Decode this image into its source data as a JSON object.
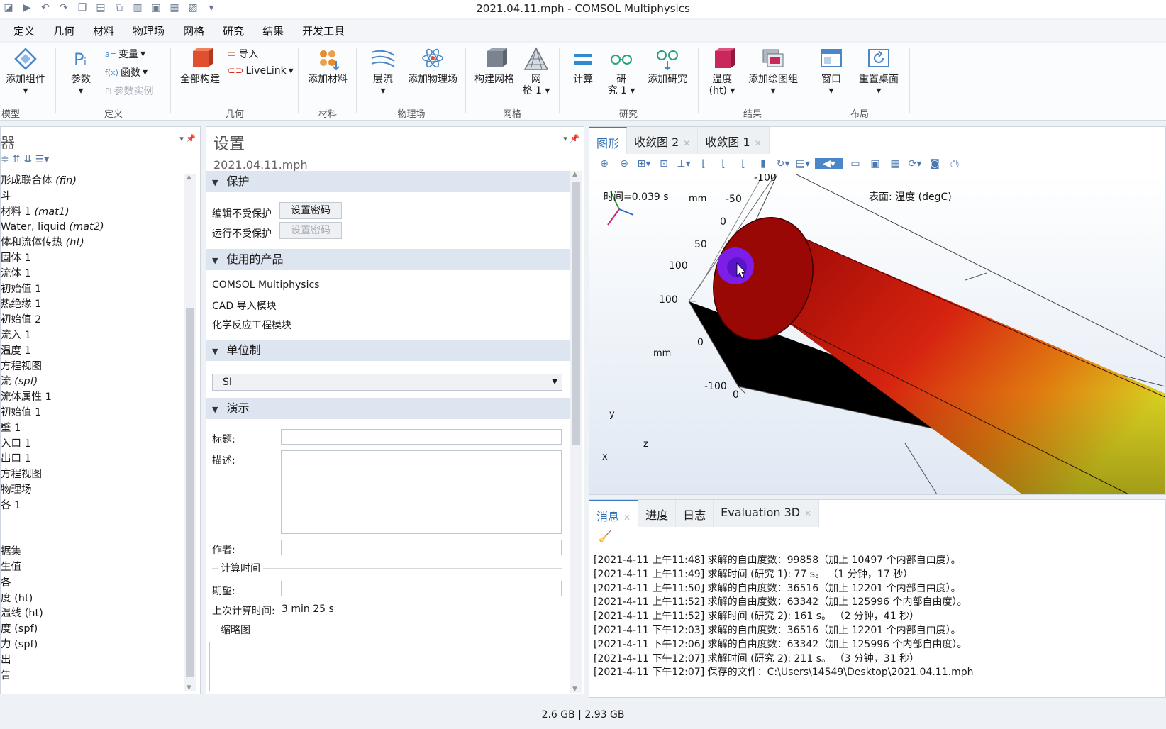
{
  "window": {
    "title": "2021.04.11.mph - COMSOL Multiphysics"
  },
  "menu": [
    "定义",
    "几何",
    "材料",
    "物理场",
    "网格",
    "研究",
    "结果",
    "开发工具"
  ],
  "ribbon": {
    "add_component": "添加组件",
    "group_model": "模型",
    "parameters": "参数",
    "variables": "变量",
    "functions": "函数",
    "param_instance": "参数实例",
    "group_definitions": "定义",
    "build_all": "全部构建",
    "import": "导入",
    "livelink": "LiveLink",
    "group_geometry": "几何",
    "add_material": "添加材料",
    "group_materials": "材料",
    "laminar_flow": "层流",
    "add_physics": "添加物理场",
    "group_physics": "物理场",
    "build_mesh": "构建网格",
    "mesh1_a": "网",
    "mesh1_b": "格 1",
    "group_mesh": "网格",
    "compute": "计算",
    "study1_a": "研",
    "study1_b": "究 1",
    "add_study": "添加研究",
    "group_study": "研究",
    "temperature_a": "温度",
    "temperature_b": "(ht)",
    "add_plot_group": "添加绘图组",
    "group_results": "结果",
    "windows": "窗口",
    "reset_desktop": "重置桌面",
    "group_layout": "布局"
  },
  "model_tree": {
    "title_fragment": "器",
    "items": [
      {
        "text": "形成联合体",
        "tag": "(fin)"
      },
      {
        "text": "斗",
        "tag": ""
      },
      {
        "text": "材料 1",
        "tag": "(mat1)"
      },
      {
        "text": "Water, liquid",
        "tag": "(mat2)"
      },
      {
        "text": "体和流体传热",
        "tag": "(ht)"
      },
      {
        "text": "固体 1",
        "tag": ""
      },
      {
        "text": "流体 1",
        "tag": ""
      },
      {
        "text": "初始值 1",
        "tag": ""
      },
      {
        "text": "热绝缘 1",
        "tag": ""
      },
      {
        "text": "初始值 2",
        "tag": ""
      },
      {
        "text": "流入 1",
        "tag": ""
      },
      {
        "text": "温度 1",
        "tag": ""
      },
      {
        "text": "方程视图",
        "tag": ""
      },
      {
        "text": "流",
        "tag": "(spf)"
      },
      {
        "text": "流体属性 1",
        "tag": ""
      },
      {
        "text": "初始值 1",
        "tag": ""
      },
      {
        "text": "壁 1",
        "tag": ""
      },
      {
        "text": "入口 1",
        "tag": ""
      },
      {
        "text": "出口 1",
        "tag": ""
      },
      {
        "text": "方程视图",
        "tag": ""
      },
      {
        "text": "物理场",
        "tag": ""
      },
      {
        "text": "各 1",
        "tag": ""
      },
      {
        "text": "",
        "tag": ""
      },
      {
        "text": "",
        "tag": ""
      },
      {
        "text": "据集",
        "tag": ""
      },
      {
        "text": "生值",
        "tag": ""
      },
      {
        "text": "各",
        "tag": ""
      },
      {
        "text": "度 (ht)",
        "tag": ""
      },
      {
        "text": "温线 (ht)",
        "tag": ""
      },
      {
        "text": "度 (spf)",
        "tag": ""
      },
      {
        "text": "力 (spf)",
        "tag": ""
      },
      {
        "text": "出",
        "tag": ""
      },
      {
        "text": "告",
        "tag": ""
      }
    ]
  },
  "settings": {
    "title": "设置",
    "subtitle": "2021.04.11.mph",
    "sec_protection": "保护",
    "edit_unprotected": "编辑不受保护",
    "run_unprotected": "运行不受保护",
    "set_password": "设置密码",
    "sec_products": "使用的产品",
    "products": [
      "COMSOL Multiphysics",
      "CAD 导入模块",
      "化学反应工程模块"
    ],
    "sec_units": "单位制",
    "unit_system": "SI",
    "sec_presentation": "演示",
    "label_title": "标题:",
    "label_description": "描述:",
    "label_author": "作者:",
    "compute_time_header": "计算时间",
    "label_expected": "期望:",
    "label_last_time": "上次计算时间:",
    "last_time_value": "3 min 25 s",
    "thumbnail_header": "缩略图"
  },
  "graphics": {
    "tabs": [
      "图形",
      "收敛图 2",
      "收敛图 1"
    ],
    "time_label": "时间=0.039 s",
    "surface_label": "表面: 温度 (degC)",
    "axis_top": [
      "-100",
      "-50",
      "0",
      "50",
      "100"
    ],
    "axis_left": [
      "100",
      "0",
      "-100"
    ],
    "axis_zero": "0",
    "unit_mm": "mm",
    "triad": [
      "y",
      "z",
      "x"
    ]
  },
  "messages": {
    "tabs": [
      "消息",
      "进度",
      "日志",
      "Evaluation 3D"
    ],
    "lines": [
      "[2021-4-11 上午11:48] 求解的自由度数：99858（加上 10497 个内部自由度）。",
      "[2021-4-11 上午11:49] 求解时间 (研究 1): 77 s。 （1 分钟，17 秒）",
      "[2021-4-11 上午11:50] 求解的自由度数：36516（加上 12201 个内部自由度）。",
      "[2021-4-11 上午11:52] 求解的自由度数：63342（加上 125996 个内部自由度）。",
      "[2021-4-11 上午11:52] 求解时间 (研究 2): 161 s。 （2 分钟，41 秒）",
      "[2021-4-11 下午12:03] 求解的自由度数：36516（加上 12201 个内部自由度）。",
      "[2021-4-11 下午12:06] 求解的自由度数：63342（加上 125996 个内部自由度）。",
      "[2021-4-11 下午12:07] 求解时间 (研究 2): 211 s。 （3 分钟，31 秒）",
      "[2021-4-11 下午12:07] 保存的文件：C:\\Users\\14549\\Desktop\\2021.04.11.mph"
    ]
  },
  "status": {
    "memory": "2.6 GB | 2.93 GB"
  }
}
